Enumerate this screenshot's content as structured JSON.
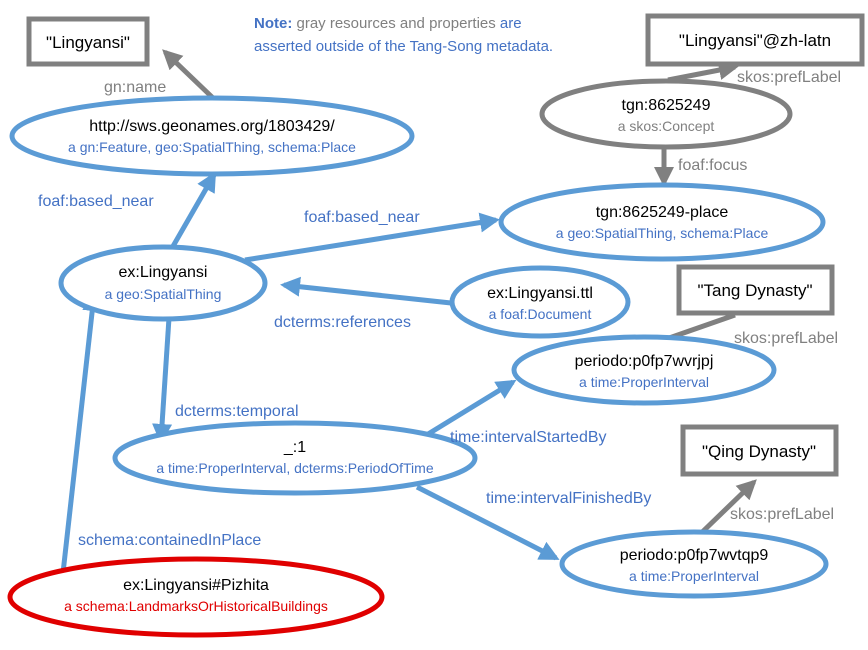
{
  "colors": {
    "blue": "#5b9bd5",
    "blue_text": "#4472c4",
    "gray": "#808080",
    "red": "#e00000",
    "black": "#000000"
  },
  "note": {
    "bold": "Note:",
    "line1_a": " gray resources and properties",
    "line1_b": " are",
    "line2": "asserted outside of the Tang-Song metadata."
  },
  "literals": {
    "lingyansi": "\"Lingyansi\"",
    "lingyansi_zh": "\"Lingyansi\"@zh-latn",
    "tang": "\"Tang Dynasty\"",
    "qing": "\"Qing Dynasty\""
  },
  "nodes": {
    "geonames": {
      "label": "http://sws.geonames.org/1803429/",
      "type": "a gn:Feature, geo:SpatialThing, schema:Place"
    },
    "tgn": {
      "label": "tgn:8625249",
      "type": "a skos:Concept"
    },
    "tgn_place": {
      "label": "tgn:8625249-place",
      "type": "a geo:SpatialThing, schema:Place"
    },
    "lingyansi": {
      "label": "ex:Lingyansi",
      "type": "a geo:SpatialThing"
    },
    "ttl": {
      "label": "ex:Lingyansi.ttl",
      "type": "a foaf:Document"
    },
    "tang": {
      "label": "periodo:p0fp7wvrjpj",
      "type": "a time:ProperInterval"
    },
    "blank": {
      "label": "_:1",
      "type": "a time:ProperInterval, dcterms:PeriodOfTime"
    },
    "qing": {
      "label": "periodo:p0fp7wvtqp9",
      "type": "a time:ProperInterval"
    },
    "pizhita": {
      "label": "ex:Lingyansi#Pizhita",
      "type": "a schema:LandmarksOrHistoricalBuildings"
    }
  },
  "edges": {
    "gn_name": "gn:name",
    "skos_pref_zh": "skos:prefLabel",
    "foaf_focus": "foaf:focus",
    "based_near_geonames": "foaf:based_near",
    "based_near_tgn": "foaf:based_near",
    "references": "dcterms:references",
    "skos_pref_tang": "skos:prefLabel",
    "temporal": "dcterms:temporal",
    "started_by": "time:intervalStartedBy",
    "finished_by": "time:intervalFinishedBy",
    "skos_pref_qing": "skos:prefLabel",
    "contained_in": "schema:containedInPlace"
  }
}
